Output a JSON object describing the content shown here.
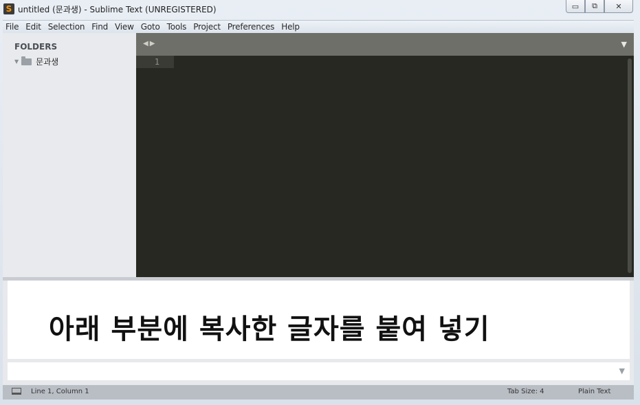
{
  "window": {
    "title": "untitled (문과생) - Sublime Text (UNREGISTERED)",
    "app_icon_glyph": "S",
    "controls": {
      "minimize": "▭",
      "restore": "⧉",
      "close": "✕"
    }
  },
  "menubar": {
    "items": [
      "File",
      "Edit",
      "Selection",
      "Find",
      "View",
      "Goto",
      "Tools",
      "Project",
      "Preferences",
      "Help"
    ]
  },
  "sidebar": {
    "heading": "FOLDERS",
    "folders": [
      {
        "name": "문과생",
        "expanded": true,
        "icon": "folder-icon"
      }
    ]
  },
  "tabbar": {
    "nav_glyph": "◀▶",
    "dropdown_glyph": "▼"
  },
  "editor": {
    "line_numbers": [
      "1"
    ],
    "content": ""
  },
  "overlay": {
    "text": "아래 부분에 복사한 글자를 붙여 넣기"
  },
  "input_panel": {
    "value": "",
    "arrow_glyph": "▼"
  },
  "statusbar": {
    "position": "Line 1, Column 1",
    "tab_size": "Tab Size: 4",
    "syntax": "Plain Text"
  },
  "colors": {
    "editor_bg": "#272822",
    "tabbar_bg": "#6f6f69",
    "sidebar_bg": "#e8eaed",
    "statusbar_bg": "#b9bec5"
  }
}
